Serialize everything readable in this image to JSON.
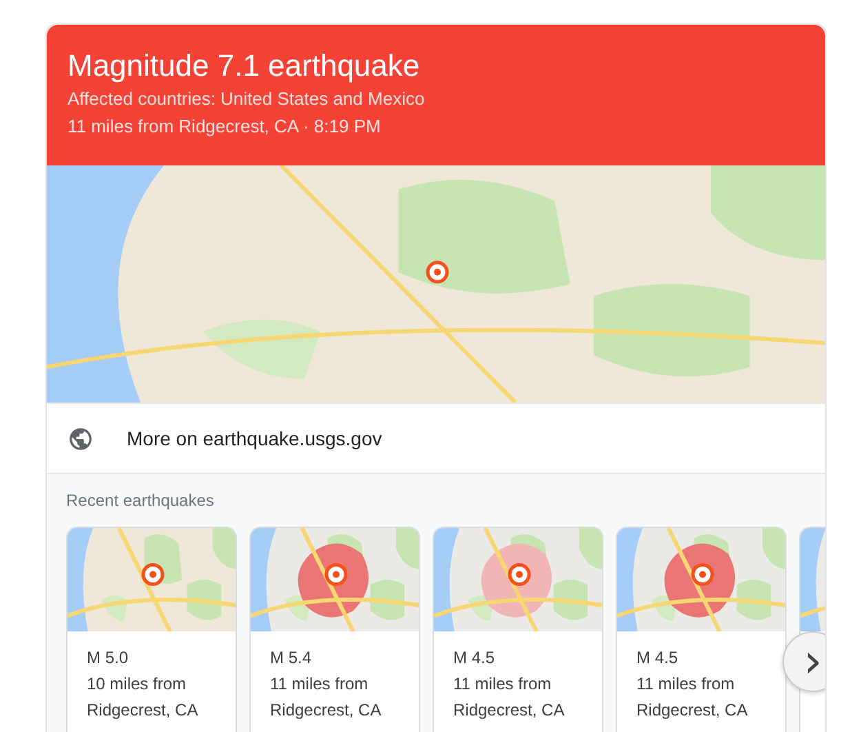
{
  "header": {
    "title": "Magnitude 7.1 earthquake",
    "affected": "Affected countries: United States and Mexico",
    "location": "11 miles from Ridgecrest, CA · 8:19 PM"
  },
  "source_link": {
    "label": "More on earthquake.usgs.gov"
  },
  "recent": {
    "title": "Recent earthquakes",
    "items": [
      {
        "magnitude": "M 5.0",
        "distance": "10 miles from",
        "place": "Ridgecrest, CA"
      },
      {
        "magnitude": "M 5.4",
        "distance": "11 miles from",
        "place": "Ridgecrest, CA"
      },
      {
        "magnitude": "M 4.5",
        "distance": "11 miles from",
        "place": "Ridgecrest, CA"
      },
      {
        "magnitude": "M 4.5",
        "distance": "11 miles from",
        "place": "Ridgecrest, CA"
      }
    ],
    "next_button": {
      "label": "›"
    }
  }
}
